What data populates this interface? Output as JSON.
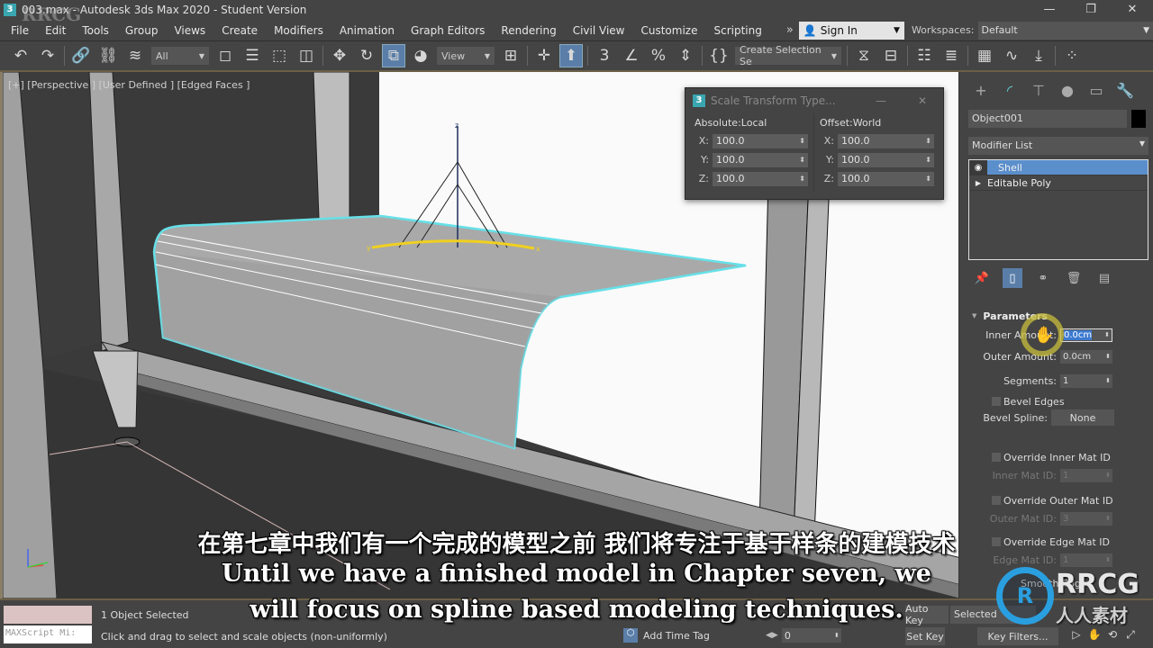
{
  "window": {
    "title": "003.max - Autodesk 3ds Max 2020 - Student Version",
    "controls": {
      "minimize": "—",
      "restore": "❐",
      "close": "✕"
    }
  },
  "menubar": {
    "items": [
      "File",
      "Edit",
      "Tools",
      "Group",
      "Views",
      "Create",
      "Modifiers",
      "Animation",
      "Graph Editors",
      "Rendering",
      "Civil View",
      "Customize",
      "Scripting"
    ],
    "more": "»",
    "sign_in": "Sign In",
    "workspaces_label": "Workspaces:",
    "workspace_value": "Default"
  },
  "toolbar": {
    "selection_filter": "All",
    "ref_coord": "View",
    "named_selection": "Create Selection Se",
    "icons": [
      "undo-icon",
      "redo-icon",
      "link-icon",
      "unlink-icon",
      "bind-space-warp-icon",
      "select-object-icon",
      "select-by-name-icon",
      "rect-region-icon",
      "window-crossing-icon",
      "move-icon",
      "rotate-icon",
      "scale-icon",
      "place-icon",
      "pivot-icon",
      "snap-3d-icon",
      "angle-snap-icon",
      "percent-snap-icon",
      "spinner-snap-icon",
      "edit-named-sel-icon",
      "mirror-icon",
      "align-icon",
      "scene-explorer-icon",
      "layer-explorer-icon",
      "toggle-ribbon-icon",
      "curve-editor-icon",
      "schematic-icon",
      "material-editor-icon"
    ]
  },
  "viewport": {
    "label": "[+] [Perspective ] [User Defined ] [Edged Faces ]",
    "gizmo_axes": {
      "x": "x",
      "y": "y",
      "z": "z"
    }
  },
  "scale_dialog": {
    "title": "Scale Transform Type...",
    "groups": [
      {
        "title": "Absolute:Local",
        "rows": [
          {
            "axis": "X:",
            "value": "100.0"
          },
          {
            "axis": "Y:",
            "value": "100.0"
          },
          {
            "axis": "Z:",
            "value": "100.0"
          }
        ]
      },
      {
        "title": "Offset:World",
        "rows": [
          {
            "axis": "X:",
            "value": "100.0"
          },
          {
            "axis": "Y:",
            "value": "100.0"
          },
          {
            "axis": "Z:",
            "value": "100.0"
          }
        ]
      }
    ]
  },
  "command_panel": {
    "tabs": [
      "create",
      "modify",
      "hierarchy",
      "motion",
      "display",
      "utilities"
    ],
    "object_name": "Object001",
    "object_color": "#000000",
    "modifier_list": "Modifier List",
    "stack": [
      {
        "label": "Shell",
        "selected": true
      },
      {
        "label": "Editable Poly",
        "selected": false
      }
    ],
    "parameters": {
      "title": "Parameters",
      "inner_amount_label": "Inner Amount:",
      "inner_amount": "0.0cm",
      "outer_amount_label": "Outer Amount:",
      "outer_amount": "0.0cm",
      "segments_label": "Segments:",
      "segments": "1",
      "bevel_edges": "Bevel Edges",
      "bevel_spline_label": "Bevel Spline:",
      "bevel_spline": "None",
      "override_inner": "Override Inner Mat ID",
      "inner_mat_label": "Inner Mat ID:",
      "inner_mat": "1",
      "override_outer": "Override Outer Mat ID",
      "outer_mat_label": "Outer Mat ID:",
      "outer_mat": "3",
      "override_edge": "Override Edge Mat ID",
      "edge_mat_label": "Edge Mat ID:",
      "edge_mat": "1",
      "smooth": "Smooth Edges"
    }
  },
  "statusbar": {
    "maxscript": "MAXScript Mi:",
    "selected": "1 Object Selected",
    "prompt": "Click and drag to select and scale objects (non-uniformly)",
    "add_time_tag": "Add Time Tag",
    "frame": "0",
    "auto_key": "Auto Key",
    "selected_drop": "Selected",
    "set_key": "Set Key",
    "key_filters": "Key Filters..."
  },
  "subtitles": {
    "chinese": "在第七章中我们有一个完成的模型之前 我们将专注于基于样条的建模技术",
    "english_line1": "Until we have a finished model in Chapter seven, we",
    "english_line2": "will focus on spline based modeling techniques."
  },
  "watermark": {
    "corner": "RRCG",
    "logo_text": "RRCG",
    "logo_sub": "人人素材"
  }
}
